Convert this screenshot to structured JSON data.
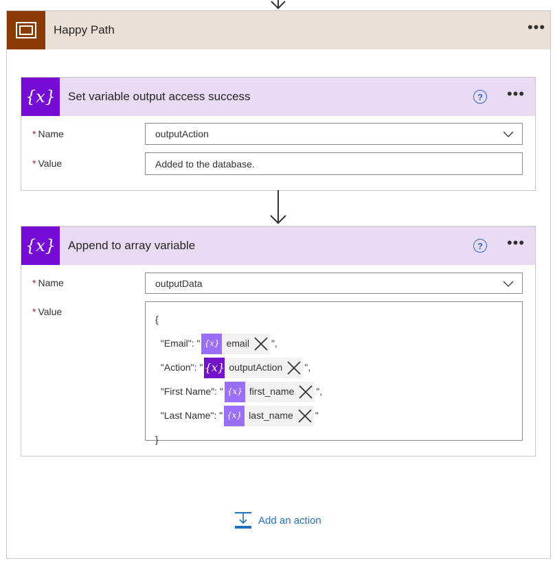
{
  "scope": {
    "title": "Happy Path",
    "menu": "•••"
  },
  "set_variable_card": {
    "title": "Set variable output access success",
    "help": "?",
    "menu": "•••",
    "name_label": "Name",
    "name_value": "outputAction",
    "value_label": "Value",
    "value_text": "Added to the database."
  },
  "append_card": {
    "title": "Append to array variable",
    "help": "?",
    "menu": "•••",
    "name_label": "Name",
    "name_value": "outputData",
    "value_label": "Value",
    "json": {
      "open": "{",
      "close": "}",
      "lines": [
        {
          "prefix": "  \"Email\": \"",
          "token": "email",
          "token_icon": "{x}",
          "suffix": "\","
        },
        {
          "prefix": "  \"Action\": \"",
          "token": "outputAction",
          "token_icon": "{x}",
          "suffix": "\","
        },
        {
          "prefix": "  \"First Name\": \"",
          "token": "first_name",
          "token_icon": "{x}",
          "suffix": "\","
        },
        {
          "prefix": "  \"Last Name\": \"",
          "token": "last_name",
          "token_icon": "{x}",
          "suffix": "\""
        }
      ]
    }
  },
  "required_mark": "*",
  "variable_icon_text": "{x}",
  "add_action": {
    "label": "Add an action"
  },
  "colors": {
    "scope_header": "#ecdfd6",
    "scope_icon": "#8a3b03",
    "card_header": "#eadbf5",
    "variable_icon": "#770bd6",
    "link": "#1f6fbf"
  }
}
